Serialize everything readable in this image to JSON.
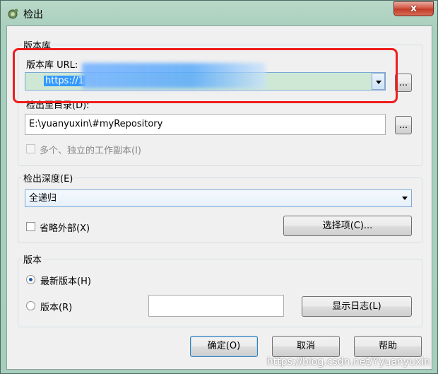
{
  "window": {
    "title": "检出",
    "close_glyph": "x"
  },
  "repository_group": {
    "label": "版本库",
    "url_label": "版本库 URL:",
    "url_value": "https://1",
    "browse_url_label": "...",
    "checkout_dir_label": "检出至目录(D):",
    "checkout_dir_value": "E:\\yuanyuxin\\#myRepository",
    "browse_dir_label": "...",
    "multiple_copies_label": "多个、独立的工作副本(I)"
  },
  "depth_group": {
    "label": "检出深度(E)",
    "depth_value": "全递归",
    "omit_externals_label": "省略外部(X)",
    "select_items_label": "选择项(C)..."
  },
  "revision_group": {
    "label": "版本",
    "head_label": "最新版本(H)",
    "revision_label": "版本(R)",
    "revision_value": "",
    "show_log_label": "显示日志(L)"
  },
  "footer": {
    "ok_label": "确定(O)",
    "cancel_label": "取消",
    "help_label": "帮助"
  },
  "watermark": "https://blog.csdn.net/Yyuanyuxin",
  "colors": {
    "highlight": "#f01d1d",
    "selection": "#3399ff"
  }
}
